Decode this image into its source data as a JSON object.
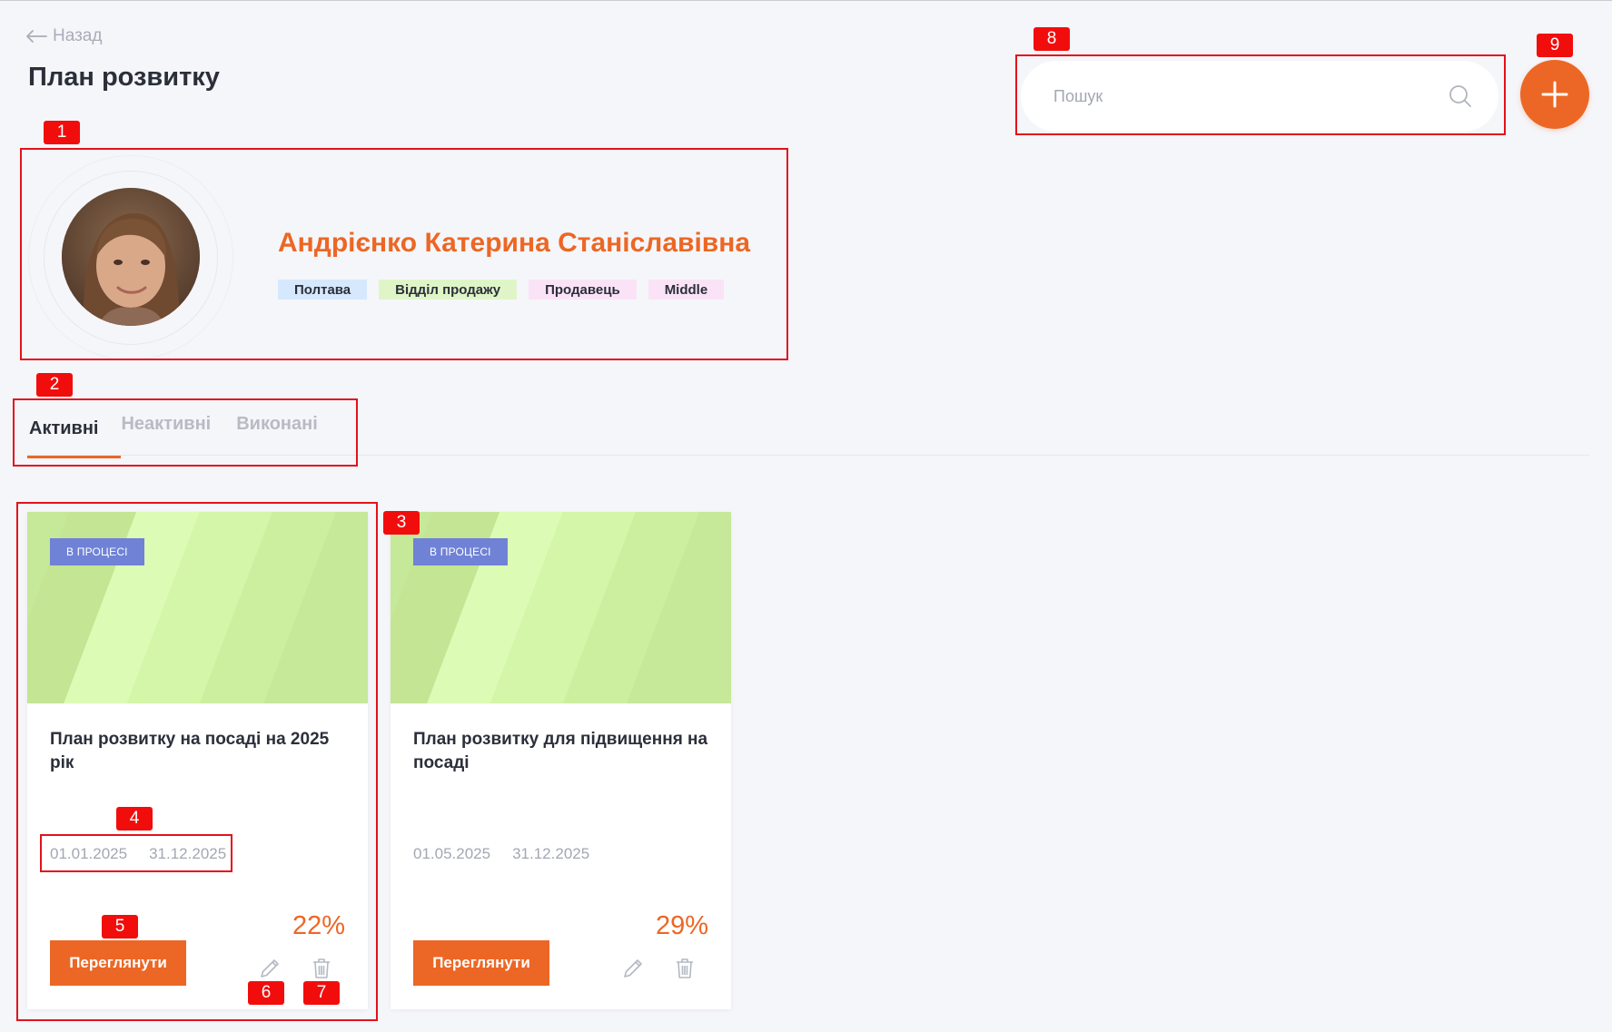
{
  "header": {
    "back_label": "Назад",
    "title": "План розвитку"
  },
  "search": {
    "placeholder": "Пошук",
    "value": ""
  },
  "profile": {
    "name": "Андрієнко Катерина Станіславівна",
    "tags": [
      {
        "label": "Полтава",
        "color": "#d6e8fd"
      },
      {
        "label": "Відділ продажу",
        "color": "#dff5c8"
      },
      {
        "label": "Продавець",
        "color": "#fbe3f7"
      },
      {
        "label": "Middle",
        "color": "#fbe3f7"
      }
    ]
  },
  "tabs": [
    {
      "label": "Активні",
      "active": true
    },
    {
      "label": "Неактивні",
      "active": false
    },
    {
      "label": "Виконані",
      "active": false
    }
  ],
  "cards": [
    {
      "status": "В ПРОЦЕСІ",
      "title": "План розвитку на посаді на 2025 рік",
      "start_date": "01.01.2025",
      "end_date": "31.12.2025",
      "progress": "22%",
      "view_label": "Переглянути"
    },
    {
      "status": "В ПРОЦЕСІ",
      "title": "План розвитку для підвищення на посаді",
      "start_date": "01.05.2025",
      "end_date": "31.12.2025",
      "progress": "29%",
      "view_label": "Переглянути"
    }
  ],
  "annotations": [
    "1",
    "2",
    "3",
    "4",
    "5",
    "6",
    "7",
    "8",
    "9"
  ],
  "colors": {
    "accent": "#ec6725",
    "status_badge": "#6f82d6",
    "annotation": "#e3121b"
  }
}
